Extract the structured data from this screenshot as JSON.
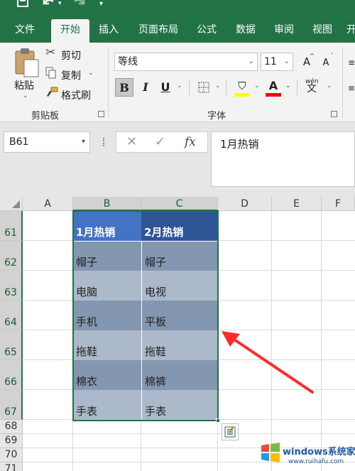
{
  "ribbon": {
    "tabs": [
      "文件",
      "开始",
      "插入",
      "页面布局",
      "公式",
      "数据",
      "审阅",
      "视图",
      "开"
    ],
    "active_tab": "开始",
    "clipboard": {
      "paste": "粘贴",
      "cut": "剪切",
      "copy": "复制",
      "format_painter": "格式刷",
      "group_label": "剪贴板"
    },
    "font": {
      "font_name": "等线",
      "font_size": "11",
      "grow": "A",
      "shrink": "A",
      "bold": "B",
      "italic": "I",
      "underline": "U",
      "group_label": "字体",
      "fill_color": "#ffff00",
      "font_color": "#ff0000",
      "phonetic": "wén"
    }
  },
  "formula_bar": {
    "name_box": "B61",
    "cancel": "✕",
    "enter": "✓",
    "fx": "fx",
    "content": "1月热销"
  },
  "grid": {
    "columns": [
      "A",
      "B",
      "C",
      "D",
      "E",
      "F"
    ],
    "rows": [
      "61",
      "62",
      "63",
      "64",
      "65",
      "66",
      "67",
      "68",
      "69",
      "70",
      "71"
    ],
    "table": {
      "headers": [
        "1月热销",
        "2月热销"
      ],
      "rows": [
        [
          "帽子",
          "帽子"
        ],
        [
          "电脑",
          "电视"
        ],
        [
          "手机",
          "平板"
        ],
        [
          "拖鞋",
          "拖鞋"
        ],
        [
          "棉衣",
          "棉裤"
        ],
        [
          "手表",
          "手表"
        ]
      ]
    },
    "colors": {
      "accent": "#217346",
      "header_b": "#4472c4",
      "header_c": "#2f5597",
      "band_dark": "#8497b0",
      "band_light": "#acb9ca",
      "arrow": "#ff2a2a"
    }
  },
  "watermark": {
    "text": "windows系统家园",
    "url": "www.ruihafu.com"
  }
}
